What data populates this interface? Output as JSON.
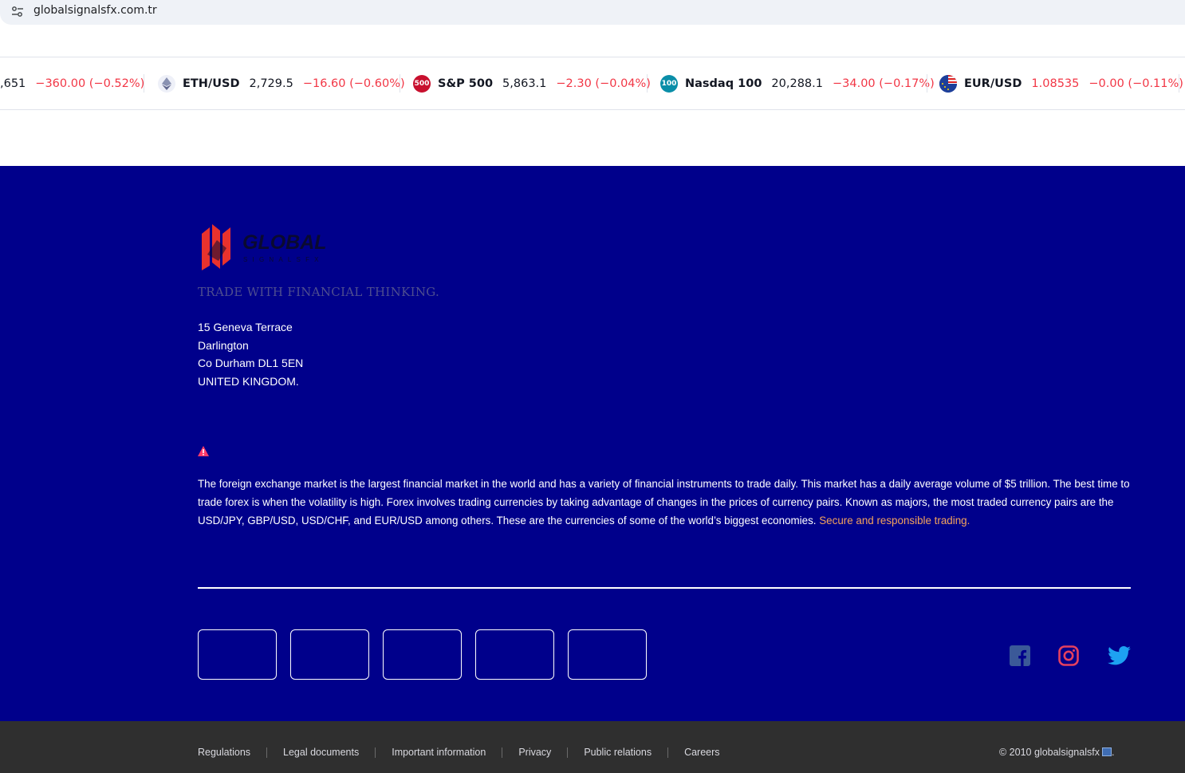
{
  "browser": {
    "url": "globalsignalsfx.com.tr",
    "site_info_icon": "tune-icon"
  },
  "ticker": [
    {
      "symbol": "",
      "price": ",651",
      "change": "−360.00 (−0.52%)",
      "icon": "none"
    },
    {
      "symbol": "ETH/USD",
      "price": "2,729.5",
      "change": "−16.60 (−0.60%)",
      "icon": "ethereum-icon"
    },
    {
      "symbol": "S&P 500",
      "price": "5,863.1",
      "change": "−2.30 (−0.04%)",
      "icon": "sp500-icon",
      "badge": "500",
      "badge_color": "#c8102e"
    },
    {
      "symbol": "Nasdaq 100",
      "price": "20,288.1",
      "change": "−34.00 (−0.17%)",
      "icon": "nasdaq-icon",
      "badge": "100",
      "badge_color": "#0a8ea8"
    },
    {
      "symbol": "EUR/USD",
      "price": "1.08535",
      "change": "−0.00 (−0.11%)",
      "icon": "eur-usd-flag-icon"
    }
  ],
  "footer": {
    "brand_name": "GLOBAL",
    "brand_sub": "SIGNALSFX",
    "tagline": "TRADE WITH FINANCIAL THINKING.",
    "address": [
      "15 Geneva Terrace",
      "Darlington",
      "Co Durham DL1 5EN",
      "UNITED KINGDOM."
    ],
    "disclaimer": "The foreign exchange market is the largest financial market in the world and has a variety of financial instruments to trade daily. This market has a daily average volume of $5 trillion. The best time to trade forex is when the volatility is high. Forex involves trading currencies by taking advantage of changes in the prices of currency pairs. Known as majors, the most traded currency pairs are the USD/JPY, GBP/USD, USD/CHF, and EUR/USD among others. These are the currencies of some of the world’s biggest economies.",
    "disclaimer_link": "Secure and responsible trading.",
    "badges": 5,
    "social": [
      "facebook-icon",
      "instagram-icon",
      "twitter-icon"
    ]
  },
  "bottom": {
    "links": [
      "Regulations",
      "Legal documents",
      "Important information",
      "Privacy",
      "Public relations",
      "Careers"
    ],
    "copyright": "© 2010 globalsignalsfx"
  },
  "colors": {
    "footer_bg": "#00008b",
    "bottom_bg": "#2f2f2f",
    "negative": "#f23645",
    "link_accent": "#f4a35c",
    "brand_red": "#e8322d"
  }
}
